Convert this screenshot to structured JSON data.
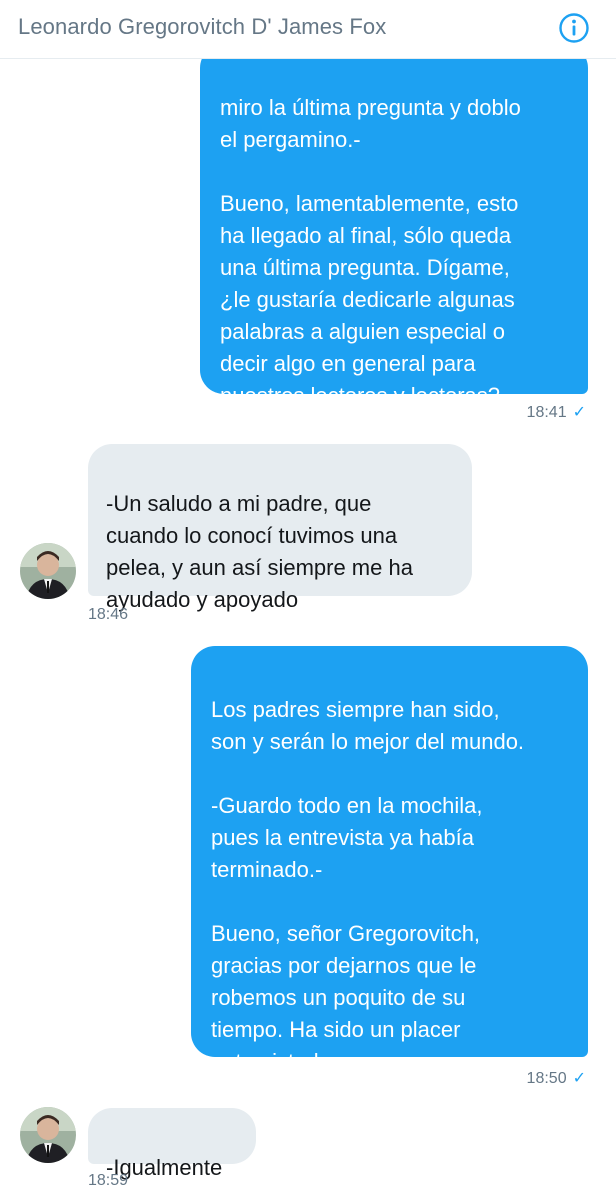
{
  "header": {
    "title": "Leonardo Gregorovitch D' James Fox",
    "info_icon": "info-icon"
  },
  "messages": [
    {
      "direction": "outgoing",
      "text": "miro la última pregunta y doblo\nel pergamino.-\n\nBueno, lamentablemente, esto\nha llegado al final, sólo queda\nuna última pregunta. Dígame,\n¿le gustaría dedicarle algunas\npalabras a alguien especial o\ndecir algo en general para\nnuestros lectores y lectoras?",
      "time": "18:41",
      "status_icon": "read-check-icon"
    },
    {
      "direction": "incoming",
      "text": "-Un saludo a mi padre, que\ncuando lo conocí tuvimos una\npelea, y aun así siempre me ha\nayudado y apoyado",
      "time": "18:46",
      "avatar_icon": "avatar"
    },
    {
      "direction": "outgoing",
      "text": "Los padres siempre han sido,\nson y serán lo mejor del mundo.\n\n-Guardo todo en la mochila,\npues la entrevista ya había\nterminado.-\n\nBueno, señor Gregorovitch,\ngracias por dejarnos que le\nrobemos un poquito de su\ntiempo. Ha sido un placer\nentrevistarle.",
      "time": "18:50",
      "status_icon": "read-check-icon"
    },
    {
      "direction": "incoming",
      "text": "-Igualmente",
      "time": "18:59",
      "avatar_icon": "avatar"
    }
  ],
  "colors": {
    "outgoing_bubble": "#1da1f2",
    "incoming_bubble": "#e6ecf0",
    "timestamp": "#657786",
    "header_title": "#657786"
  }
}
